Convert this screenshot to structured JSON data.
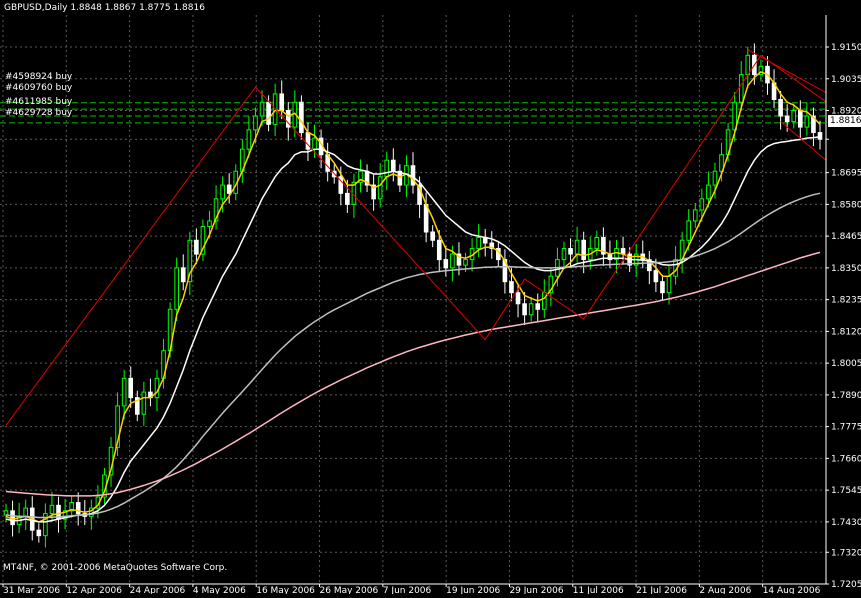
{
  "header": {
    "symbol": "GBPUSD,Daily",
    "open": "1.8848",
    "high": "1.8867",
    "low": "1.8775",
    "close": "1.8816"
  },
  "copyright": "MT4NF, © 2001-2006 MetaQuotes Software Corp.",
  "current_price": "1.8816",
  "orders": [
    "#4598924 buy",
    "#4609760 buy",
    "#4611985 buy",
    "#4629728 buy"
  ],
  "colors": {
    "background": "#000000",
    "grid": "#5a5a5a",
    "bull_candle": "#00ff00",
    "bear_candle": "#ffffff",
    "ma_fast": "#ffd000",
    "ma_mid": "#ffffff",
    "ma_slow": "#c0c0c0",
    "ma_slowest": "#ffb6c1",
    "zigzag": "#e00000",
    "order_lines": "#00c000"
  },
  "chart_data": {
    "type": "candlestick",
    "title": "GBPUSD,Daily",
    "ylim": [
      1.7205,
      1.9208
    ],
    "y_ticks": [
      "1.9150",
      "1.9035",
      "1.8920",
      "1.8816",
      "1.8695",
      "1.8580",
      "1.8465",
      "1.8350",
      "1.8235",
      "1.8120",
      "1.8005",
      "1.7890",
      "1.7775",
      "1.7660",
      "1.7545",
      "1.7430",
      "1.7320",
      "1.7205"
    ],
    "x_tick_labels": [
      "31 Mar 2006",
      "12 Apr 2006",
      "24 Apr 2006",
      "4 May 2006",
      "16 May 2006",
      "26 May 2006",
      "7 Jun 2006",
      "19 Jun 2006",
      "29 Jun 2006",
      "11 Jul 2006",
      "21 Jul 2006",
      "2 Aug 2006",
      "14 Aug 2006"
    ],
    "grid": true,
    "order_levels": [
      1.8948,
      1.8925,
      1.89,
      1.8875
    ],
    "candles_close": [
      1.747,
      1.742,
      1.745,
      1.748,
      1.74,
      1.738,
      1.746,
      1.749,
      1.744,
      1.747,
      1.75,
      1.746,
      1.745,
      1.748,
      1.752,
      1.76,
      1.77,
      1.785,
      1.795,
      1.788,
      1.782,
      1.79,
      1.788,
      1.795,
      1.805,
      1.82,
      1.835,
      1.83,
      1.845,
      1.84,
      1.85,
      1.852,
      1.86,
      1.865,
      1.862,
      1.87,
      1.878,
      1.885,
      1.89,
      1.895,
      1.887,
      1.898,
      1.892,
      1.886,
      1.895,
      1.884,
      1.878,
      1.882,
      1.876,
      1.87,
      1.868,
      1.862,
      1.858,
      1.866,
      1.87,
      1.865,
      1.86,
      1.868,
      1.874,
      1.87,
      1.865,
      1.872,
      1.865,
      1.858,
      1.848,
      1.845,
      1.838,
      1.835,
      1.84,
      1.836,
      1.838,
      1.842,
      1.846,
      1.844,
      1.842,
      1.838,
      1.83,
      1.826,
      1.822,
      1.818,
      1.822,
      1.82,
      1.826,
      1.832,
      1.838,
      1.842,
      1.84,
      1.845,
      1.838,
      1.842,
      1.846,
      1.84,
      1.838,
      1.842,
      1.84,
      1.836,
      1.84,
      1.838,
      1.834,
      1.83,
      1.826,
      1.832,
      1.838,
      1.845,
      1.852,
      1.856,
      1.86,
      1.865,
      1.87,
      1.876,
      1.885,
      1.895,
      1.905,
      1.912,
      1.905,
      1.908,
      1.902,
      1.896,
      1.89,
      1.888,
      1.892,
      1.886,
      1.89,
      1.884,
      1.8816
    ],
    "series": [
      {
        "name": "ma_fast",
        "values": [
          1.745,
          1.744,
          1.7445,
          1.745,
          1.744,
          1.743,
          1.744,
          1.7455,
          1.746,
          1.7465,
          1.7475,
          1.747,
          1.7465,
          1.747,
          1.749,
          1.754,
          1.762,
          1.772,
          1.782,
          1.786,
          1.787,
          1.788,
          1.788,
          1.79,
          1.795,
          1.805,
          1.818,
          1.824,
          1.833,
          1.837,
          1.842,
          1.847,
          1.853,
          1.858,
          1.861,
          1.865,
          1.87,
          1.876,
          1.882,
          1.888,
          1.889,
          1.892,
          1.892,
          1.89,
          1.891,
          1.888,
          1.884,
          1.883,
          1.88,
          1.876,
          1.873,
          1.869,
          1.865,
          1.865,
          1.867,
          1.866,
          1.864,
          1.865,
          1.868,
          1.869,
          1.868,
          1.869,
          1.867,
          1.864,
          1.858,
          1.853,
          1.847,
          1.842,
          1.841,
          1.839,
          1.8385,
          1.8395,
          1.8415,
          1.8425,
          1.8425,
          1.841,
          1.8375,
          1.833,
          1.829,
          1.825,
          1.824,
          1.823,
          1.824,
          1.827,
          1.831,
          1.835,
          1.837,
          1.84,
          1.8395,
          1.84,
          1.8415,
          1.841,
          1.84,
          1.8405,
          1.84,
          1.839,
          1.8392,
          1.839,
          1.8375,
          1.835,
          1.832,
          1.832,
          1.834,
          1.838,
          1.843,
          1.848,
          1.853,
          1.858,
          1.863,
          1.869,
          1.876,
          1.884,
          1.893,
          1.901,
          1.904,
          1.906,
          1.905,
          1.902,
          1.898,
          1.895,
          1.894,
          1.892,
          1.8915,
          1.8895,
          1.887
        ]
      },
      {
        "name": "ma_mid",
        "values": [
          1.744,
          1.7435,
          1.7435,
          1.744,
          1.7435,
          1.743,
          1.743,
          1.7435,
          1.744,
          1.7445,
          1.745,
          1.7455,
          1.7455,
          1.746,
          1.747,
          1.749,
          1.752,
          1.756,
          1.761,
          1.765,
          1.768,
          1.771,
          1.774,
          1.777,
          1.781,
          1.786,
          1.792,
          1.798,
          1.805,
          1.811,
          1.817,
          1.822,
          1.827,
          1.832,
          1.836,
          1.84,
          1.845,
          1.85,
          1.855,
          1.86,
          1.864,
          1.868,
          1.871,
          1.873,
          1.876,
          1.877,
          1.877,
          1.878,
          1.878,
          1.877,
          1.876,
          1.874,
          1.872,
          1.871,
          1.8705,
          1.87,
          1.869,
          1.869,
          1.8695,
          1.87,
          1.8695,
          1.869,
          1.868,
          1.866,
          1.863,
          1.86,
          1.857,
          1.854,
          1.852,
          1.85,
          1.848,
          1.847,
          1.8465,
          1.846,
          1.8455,
          1.8445,
          1.843,
          1.841,
          1.839,
          1.837,
          1.8355,
          1.8345,
          1.834,
          1.834,
          1.8345,
          1.835,
          1.8355,
          1.8365,
          1.837,
          1.8375,
          1.838,
          1.8385,
          1.8385,
          1.8385,
          1.8385,
          1.838,
          1.838,
          1.8378,
          1.8375,
          1.837,
          1.8362,
          1.836,
          1.8362,
          1.837,
          1.8385,
          1.8405,
          1.8425,
          1.845,
          1.848,
          1.851,
          1.855,
          1.86,
          1.865,
          1.87,
          1.874,
          1.877,
          1.879,
          1.88,
          1.8805,
          1.8808,
          1.8812,
          1.8815,
          1.882,
          1.8822,
          1.8825
        ]
      },
      {
        "name": "ma_slow",
        "values": [
          1.7455,
          1.7452,
          1.745,
          1.745,
          1.7448,
          1.7446,
          1.7446,
          1.7447,
          1.7448,
          1.745,
          1.7452,
          1.7454,
          1.7456,
          1.7458,
          1.7462,
          1.7468,
          1.7476,
          1.7486,
          1.7498,
          1.7512,
          1.7526,
          1.754,
          1.7555,
          1.757,
          1.7588,
          1.7608,
          1.763,
          1.7655,
          1.7682,
          1.771,
          1.774,
          1.7768,
          1.7796,
          1.7824,
          1.785,
          1.7876,
          1.7902,
          1.7928,
          1.7955,
          1.7982,
          1.8008,
          1.8034,
          1.8058,
          1.808,
          1.8102,
          1.812,
          1.8138,
          1.8155,
          1.817,
          1.8185,
          1.8198,
          1.821,
          1.8222,
          1.8234,
          1.8246,
          1.8258,
          1.8268,
          1.8278,
          1.8288,
          1.8298,
          1.8306,
          1.8314,
          1.832,
          1.8326,
          1.833,
          1.8334,
          1.8337,
          1.834,
          1.8342,
          1.8344,
          1.8346,
          1.8348,
          1.835,
          1.8352,
          1.8353,
          1.8354,
          1.8354,
          1.8354,
          1.8353,
          1.8352,
          1.8351,
          1.835,
          1.835,
          1.835,
          1.8351,
          1.8352,
          1.8353,
          1.8355,
          1.8356,
          1.8358,
          1.836,
          1.8361,
          1.8362,
          1.8363,
          1.8364,
          1.8365,
          1.8366,
          1.8367,
          1.8368,
          1.8369,
          1.837,
          1.8372,
          1.8375,
          1.838,
          1.8386,
          1.8393,
          1.8401,
          1.841,
          1.842,
          1.8432,
          1.8445,
          1.846,
          1.8476,
          1.8493,
          1.851,
          1.8526,
          1.8541,
          1.8555,
          1.8568,
          1.858,
          1.859,
          1.86,
          1.8608,
          1.8615,
          1.862
        ]
      },
      {
        "name": "ma_slowest",
        "values": [
          1.754,
          1.7538,
          1.7536,
          1.7534,
          1.7532,
          1.753,
          1.7528,
          1.7527,
          1.7526,
          1.7525,
          1.7524,
          1.7524,
          1.7524,
          1.7524,
          1.7526,
          1.7528,
          1.7532,
          1.7536,
          1.7542,
          1.7548,
          1.7555,
          1.7562,
          1.757,
          1.7578,
          1.7587,
          1.7597,
          1.7607,
          1.7618,
          1.763,
          1.7642,
          1.7655,
          1.7668,
          1.7681,
          1.7694,
          1.7708,
          1.7722,
          1.7736,
          1.775,
          1.7765,
          1.778,
          1.7795,
          1.781,
          1.7825,
          1.784,
          1.7854,
          1.7868,
          1.7882,
          1.7895,
          1.7908,
          1.792,
          1.7932,
          1.7944,
          1.7955,
          1.7966,
          1.7977,
          1.7988,
          1.7998,
          1.8008,
          1.8018,
          1.8028,
          1.8037,
          1.8046,
          1.8054,
          1.8062,
          1.8069,
          1.8076,
          1.8083,
          1.8089,
          1.8095,
          1.8101,
          1.8107,
          1.8112,
          1.8117,
          1.8122,
          1.8127,
          1.8131,
          1.8135,
          1.8139,
          1.8143,
          1.8147,
          1.8151,
          1.8155,
          1.8159,
          1.8163,
          1.8167,
          1.8171,
          1.8175,
          1.8179,
          1.8183,
          1.8187,
          1.8191,
          1.8195,
          1.8199,
          1.8203,
          1.8207,
          1.8211,
          1.8215,
          1.8219,
          1.8223,
          1.8228,
          1.8233,
          1.8238,
          1.8243,
          1.8249,
          1.8255,
          1.8261,
          1.8268,
          1.8275,
          1.8282,
          1.829,
          1.8298,
          1.8306,
          1.8314,
          1.8322,
          1.833,
          1.8338,
          1.8346,
          1.8354,
          1.8362,
          1.837,
          1.8378,
          1.8386,
          1.8393,
          1.84,
          1.8406
        ]
      }
    ],
    "zigzag": [
      [
        0,
        1.778
      ],
      [
        38,
        1.9005
      ],
      [
        73,
        1.809
      ],
      [
        79,
        1.831
      ],
      [
        88,
        1.8165
      ],
      [
        115,
        1.912
      ],
      [
        125,
        1.895
      ]
    ]
  }
}
